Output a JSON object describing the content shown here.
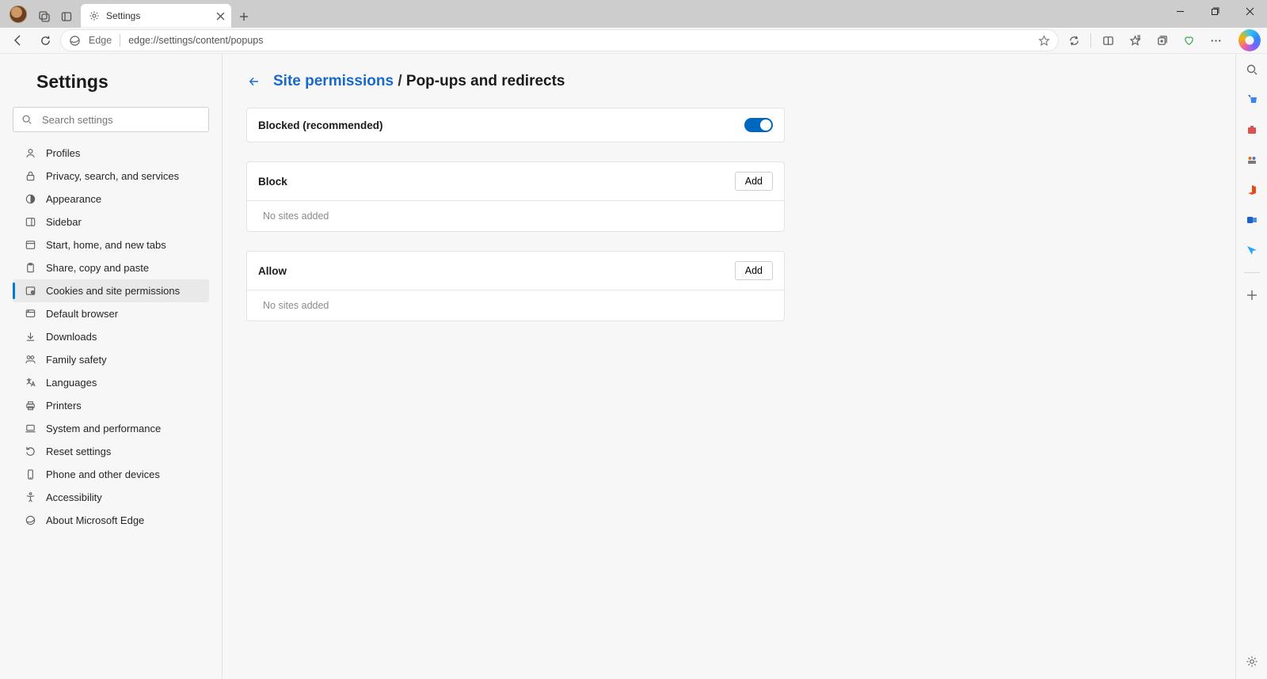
{
  "tab": {
    "title": "Settings"
  },
  "omnibox": {
    "edge_label": "Edge",
    "url": "edge://settings/content/popups"
  },
  "settings": {
    "heading": "Settings",
    "search_placeholder": "Search settings",
    "nav": [
      {
        "label": "Profiles"
      },
      {
        "label": "Privacy, search, and services"
      },
      {
        "label": "Appearance"
      },
      {
        "label": "Sidebar"
      },
      {
        "label": "Start, home, and new tabs"
      },
      {
        "label": "Share, copy and paste"
      },
      {
        "label": "Cookies and site permissions"
      },
      {
        "label": "Default browser"
      },
      {
        "label": "Downloads"
      },
      {
        "label": "Family safety"
      },
      {
        "label": "Languages"
      },
      {
        "label": "Printers"
      },
      {
        "label": "System and performance"
      },
      {
        "label": "Reset settings"
      },
      {
        "label": "Phone and other devices"
      },
      {
        "label": "Accessibility"
      },
      {
        "label": "About Microsoft Edge"
      }
    ]
  },
  "page": {
    "breadcrumb_parent": "Site permissions",
    "breadcrumb_current": "Pop-ups and redirects",
    "blocked_label": "Blocked (recommended)",
    "blocked_on": true,
    "block_section": {
      "title": "Block",
      "add": "Add",
      "empty": "No sites added"
    },
    "allow_section": {
      "title": "Allow",
      "add": "Add",
      "empty": "No sites added"
    }
  }
}
